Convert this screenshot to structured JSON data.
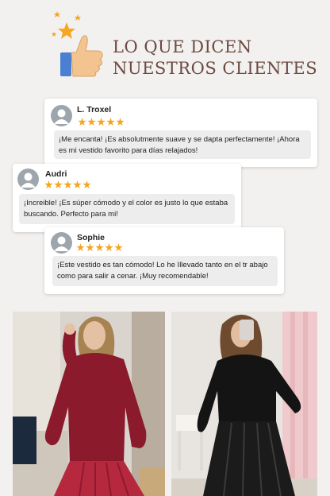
{
  "header": {
    "title_line1": "LO QUE DICEN",
    "title_line2": "NUESTROS CLIENTES"
  },
  "reviews": [
    {
      "name": "L. Troxel",
      "rating": 5,
      "text": "¡Me encanta! ¡Es absolutmente suave y se dapta perfectamente! ¡Ahora es mi vestido favorito para días relajados!"
    },
    {
      "name": "Audri",
      "rating": 5,
      "text": "¡Increible! ¡Es súper cómodo y el color es justo lo que estaba buscando. Perfecto para mi!"
    },
    {
      "name": "Sophie",
      "rating": 5,
      "text": "¡Este vestido es tan cómodo! Lo he Illevado tanto en el tr abajo como para salir a cenar. ¡Muy recomendable!"
    }
  ],
  "colors": {
    "title": "#6b4a41",
    "star": "#f4a51c",
    "burgundy_sweater": "#8a1a2c",
    "burgundy_skirt": "#b5283d",
    "black_outfit": "#141414"
  },
  "icons": [
    "thumbs-up-icon",
    "sparkle-star-icon",
    "avatar-icon",
    "star-icon"
  ]
}
